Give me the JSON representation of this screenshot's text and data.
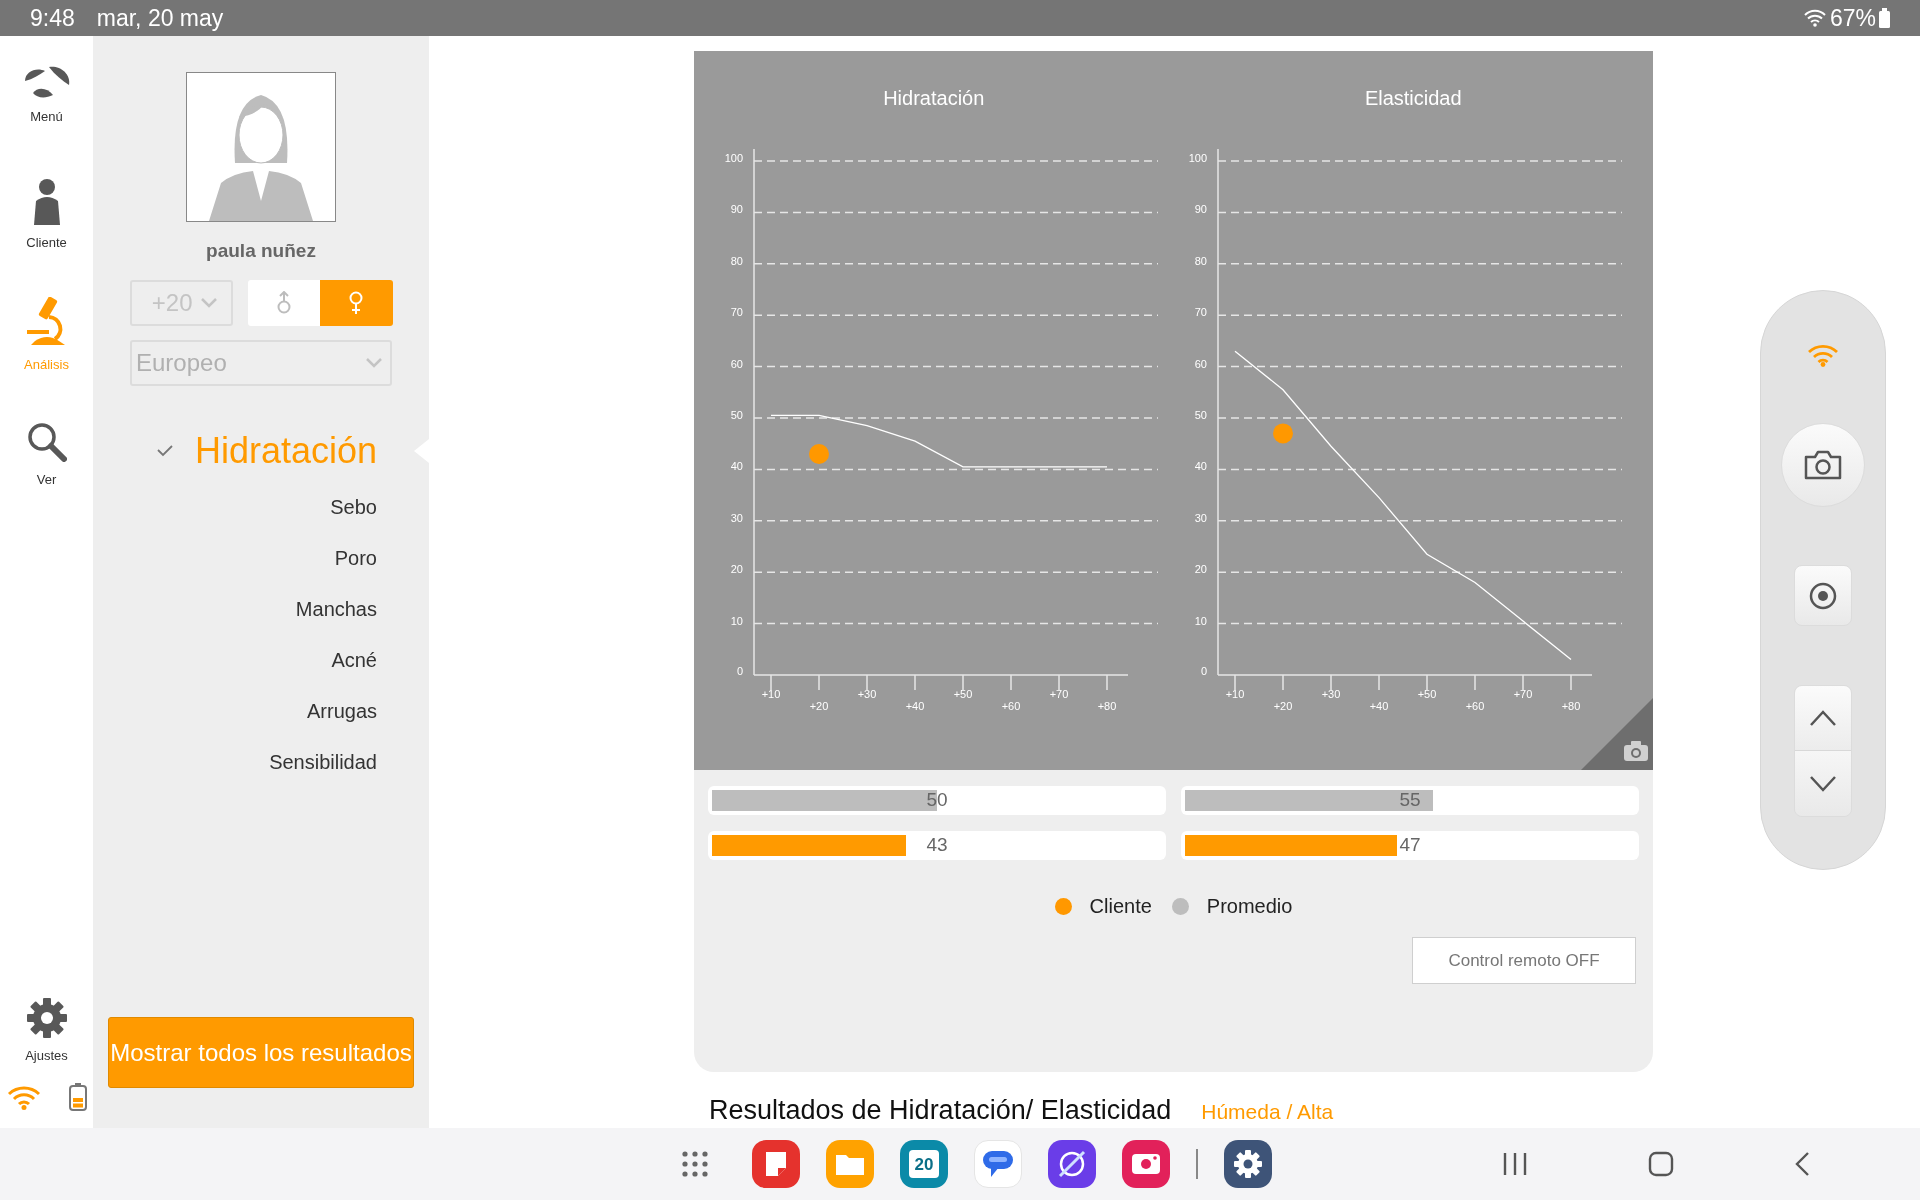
{
  "status_bar": {
    "time": "9:48",
    "date": "mar, 20 may",
    "battery": "67%"
  },
  "nav": [
    {
      "kind": "menu",
      "label": "Menú",
      "selected": false
    },
    {
      "kind": "client",
      "label": "Cliente",
      "selected": false
    },
    {
      "kind": "analysis",
      "label": "Análisis",
      "selected": true
    },
    {
      "kind": "view",
      "label": "Ver",
      "selected": false
    },
    {
      "kind": "settings",
      "label": "Ajustes",
      "selected": false
    }
  ],
  "profile": {
    "name": "paula nuñez",
    "age": "+20",
    "ethnicity": "Europeo",
    "gender": [
      {
        "kind": "male",
        "selected": false
      },
      {
        "kind": "female",
        "selected": true
      }
    ]
  },
  "analyses": [
    {
      "label": "Hidratación",
      "selected": true
    },
    {
      "label": "Sebo",
      "selected": false
    },
    {
      "label": "Poro",
      "selected": false
    },
    {
      "label": "Manchas",
      "selected": false
    },
    {
      "label": "Acné",
      "selected": false
    },
    {
      "label": "Arrugas",
      "selected": false
    },
    {
      "label": "Sensibilidad",
      "selected": false
    }
  ],
  "show_all_button": "Mostrar todos los resultados",
  "charts": [
    {
      "chart_data": {
        "type": "line",
        "title": "Hidratación",
        "grid": true,
        "categories": [
          "+10",
          "+20",
          "+30",
          "+40",
          "+50",
          "+60",
          "+70",
          "+80"
        ],
        "ylim": [
          0,
          100
        ],
        "yticks": [
          0,
          10,
          20,
          30,
          40,
          50,
          60,
          70,
          80,
          90,
          100
        ],
        "series": [
          {
            "color": "#ffffff",
            "values": [
              50.5,
              50.5,
              48.5,
              45.5,
              40.5,
              40.5,
              40.5,
              40.5
            ]
          },
          {
            "color": "#ff9800",
            "marker": "circle",
            "values": [
              null,
              43,
              null,
              null,
              null,
              null,
              null,
              null
            ]
          }
        ]
      },
      "bars": [
        {
          "kind": "average",
          "level": 0.5,
          "reading": "50"
        },
        {
          "kind": "client",
          "level": 0.43,
          "reading": "43"
        }
      ]
    },
    {
      "chart_data": {
        "type": "line",
        "title": "Elasticidad",
        "grid": true,
        "categories": [
          "+10",
          "+20",
          "+30",
          "+40",
          "+50",
          "+60",
          "+70",
          "+80"
        ],
        "ylim": [
          0,
          100
        ],
        "yticks": [
          0,
          10,
          20,
          30,
          40,
          50,
          60,
          70,
          80,
          90,
          100
        ],
        "series": [
          {
            "color": "#ffffff",
            "values": [
              63,
              55.5,
              44.5,
              34.5,
              23.5,
              18,
              10.5,
              3
            ]
          },
          {
            "color": "#ff9800",
            "marker": "circle",
            "values": [
              null,
              47,
              null,
              null,
              null,
              null,
              null,
              null
            ]
          }
        ]
      },
      "bars": [
        {
          "kind": "average",
          "level": 0.55,
          "reading": "55"
        },
        {
          "kind": "client",
          "level": 0.47,
          "reading": "47"
        }
      ]
    }
  ],
  "legend": [
    {
      "label": "Cliente",
      "color": "#ff9800"
    },
    {
      "label": "Promedio",
      "color": "#bdbdbd"
    }
  ],
  "remote_button": "Control remoto OFF",
  "results": {
    "label": "Resultados de Hidratación/ Elasticidad",
    "value": "Húmeda / Alta"
  },
  "taskbar": [
    {
      "kind": "notes"
    },
    {
      "kind": "files"
    },
    {
      "kind": "calendar",
      "badge": "20"
    },
    {
      "kind": "messages"
    },
    {
      "kind": "browser"
    },
    {
      "kind": "camera"
    },
    {
      "kind": "settings"
    }
  ]
}
